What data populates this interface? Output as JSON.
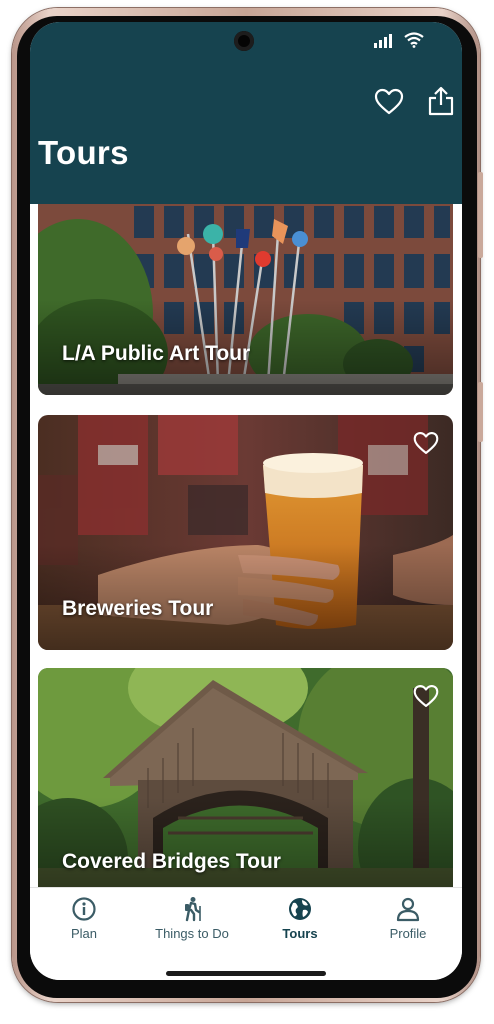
{
  "header": {
    "title": "Tours",
    "actions": [
      {
        "icon": "heart-outline-icon"
      },
      {
        "icon": "share-icon"
      }
    ],
    "status": {
      "signal_icon": "signal-icon",
      "wifi_icon": "wifi-icon"
    }
  },
  "tours": [
    {
      "title": "L/A Public Art Tour",
      "image": "public-art-sculpture-photo",
      "favorite_icon": "heart-outline-icon"
    },
    {
      "title": "Breweries Tour",
      "image": "beer-glass-photo",
      "favorite_icon": "heart-outline-icon"
    },
    {
      "title": "Covered Bridges Tour",
      "image": "covered-bridge-photo",
      "favorite_icon": "heart-outline-icon"
    }
  ],
  "tabs": [
    {
      "label": "Plan",
      "icon": "info-icon"
    },
    {
      "label": "Things to Do",
      "icon": "hiker-icon"
    },
    {
      "label": "Tours",
      "icon": "globe-icon",
      "active": true
    },
    {
      "label": "Profile",
      "icon": "person-icon"
    }
  ],
  "colors": {
    "header": "#16434f",
    "tab_active": "#16434f",
    "tab_inactive": "#3b5c66"
  }
}
